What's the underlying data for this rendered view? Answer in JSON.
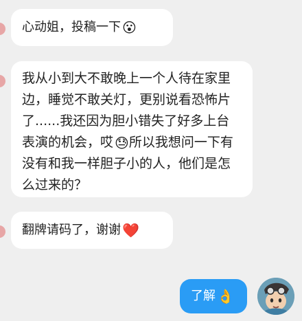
{
  "messages": [
    {
      "text": "心动姐，投稿一下",
      "emoji": "😮"
    },
    {
      "text": "我从小到大不敢晚上一个人待在家里边，睡觉不敢关灯，更别说看恐怖片了......我还因为胆小错失了好多上台表演的机会，哎",
      "emoji": "😓",
      "text_after": "所以我想问一下有没有和我一样胆子小的人，他们是怎么过来的？"
    },
    {
      "text": "翻牌请码了，谢谢",
      "emoji": "❤️"
    }
  ],
  "reply": {
    "text": "了解",
    "emoji": "👌"
  }
}
